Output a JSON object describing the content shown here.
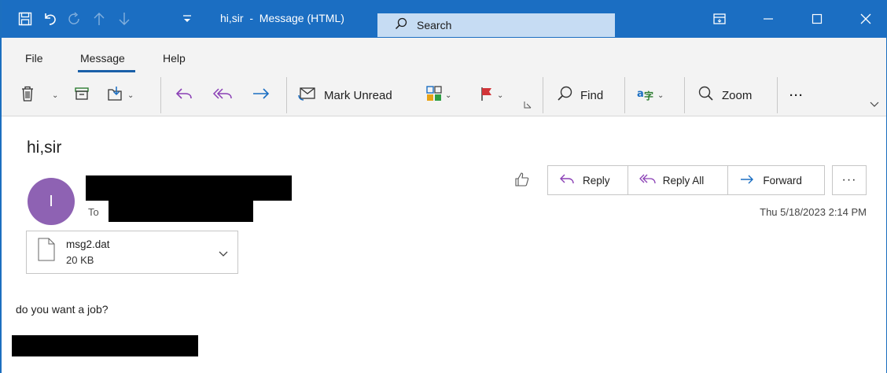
{
  "titlebar": {
    "title": "hi,sir  -  Message (HTML)",
    "search_label": "Search",
    "colors": {
      "bar": "#1b6ec2",
      "search_bg": "#c6dcf3"
    }
  },
  "menu": {
    "items": [
      "File",
      "Message",
      "Help"
    ]
  },
  "ribbon": {
    "mark_unread": "Mark Unread",
    "find": "Find",
    "zoom": "Zoom",
    "more": "···"
  },
  "message": {
    "subject": "hi,sir",
    "avatar_initial": "I",
    "to_label": "To",
    "date": "Thu 5/18/2023 2:14 PM",
    "body": "do you want a job?",
    "actions": {
      "reply": "Reply",
      "reply_all": "Reply All",
      "forward": "Forward",
      "more": "···"
    },
    "attachment": {
      "name": "msg2.dat",
      "size": "20 KB"
    },
    "avatar_color": "#8e62b3"
  }
}
